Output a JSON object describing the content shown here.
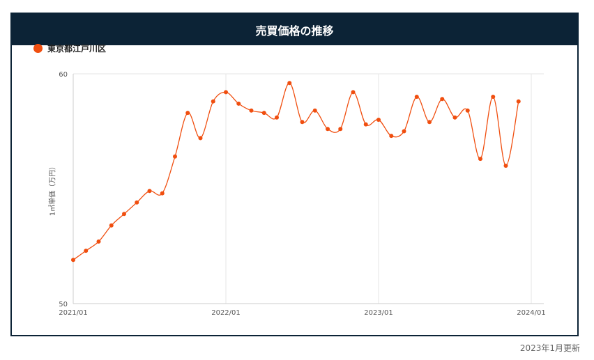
{
  "panel": {
    "title": "売買価格の推移"
  },
  "footer": {
    "updated": "2023年1月更新"
  },
  "colors": {
    "header_bg": "#0c2336",
    "series": "#f04e0f",
    "grid": "#e6e6e6",
    "axis": "#cccccc"
  },
  "chart_data": {
    "type": "line",
    "ylabel": "1㎡単価（万円）",
    "ylim": [
      50,
      60
    ],
    "y_ticks": [
      "60",
      "50"
    ],
    "x_ticks": [
      "2021/01",
      "2022/01",
      "2023/01",
      "2024/01"
    ],
    "grid": true,
    "legend_position": "top-left",
    "series": [
      {
        "name": "東京都江戸川区",
        "x": [
          "2021/01",
          "2021/02",
          "2021/03",
          "2021/04",
          "2021/05",
          "2021/06",
          "2021/07",
          "2021/08",
          "2021/09",
          "2021/10",
          "2021/11",
          "2021/12",
          "2022/01",
          "2022/02",
          "2022/03",
          "2022/04",
          "2022/05",
          "2022/06",
          "2022/07",
          "2022/08",
          "2022/09",
          "2022/10",
          "2022/11",
          "2022/12",
          "2023/01",
          "2023/02",
          "2023/03",
          "2023/04",
          "2023/05",
          "2023/06",
          "2023/07",
          "2023/08",
          "2023/09",
          "2023/10",
          "2023/11",
          "2023/12"
        ],
        "values": [
          51.9,
          52.3,
          52.7,
          53.4,
          53.9,
          54.4,
          54.9,
          54.8,
          56.4,
          58.3,
          57.2,
          58.8,
          59.2,
          58.7,
          58.4,
          58.3,
          58.1,
          59.6,
          57.9,
          58.4,
          57.6,
          57.6,
          59.2,
          57.8,
          58.0,
          57.3,
          57.5,
          59.0,
          57.9,
          58.9,
          58.1,
          58.4,
          56.3,
          59.0,
          56.0,
          58.8
        ]
      }
    ]
  }
}
